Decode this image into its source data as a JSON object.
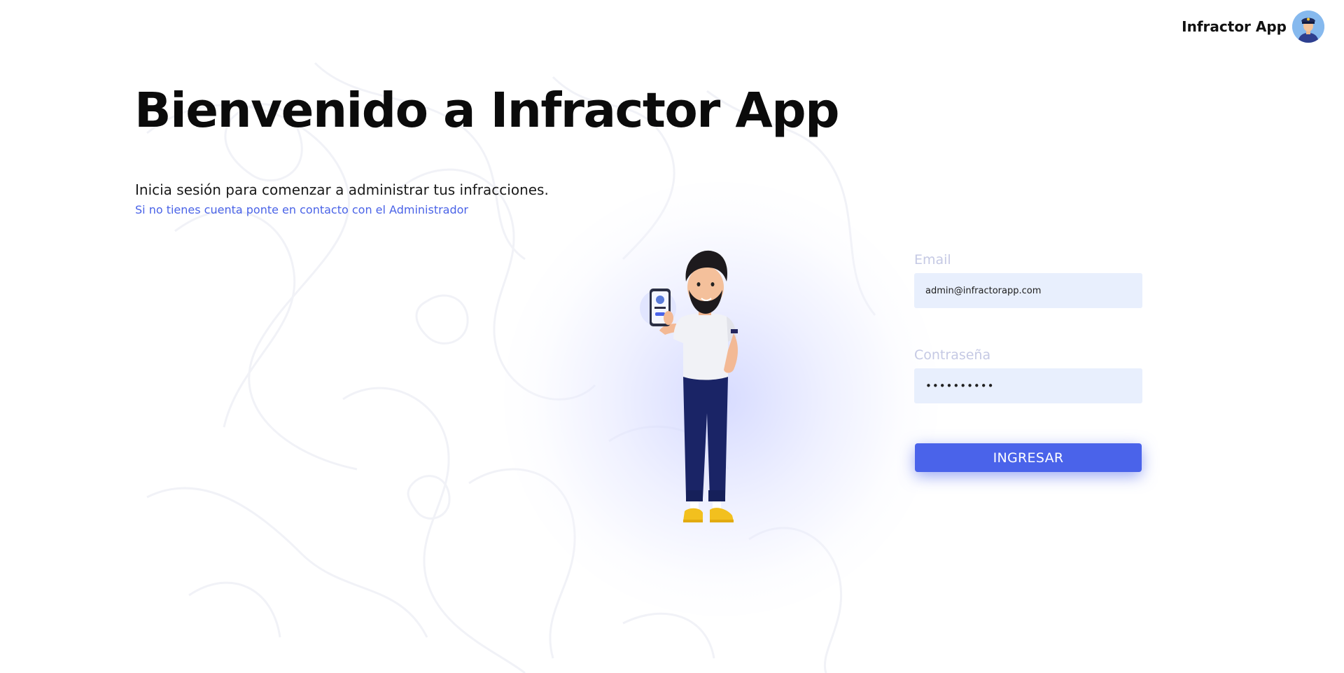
{
  "header": {
    "brand_name": "Infractor App",
    "avatar_icon": "police-officer-avatar-icon"
  },
  "hero": {
    "title": "Bienvenido a Infractor App",
    "subtitle": "Inicia sesión para comenzar a administrar tus infracciones.",
    "contact_link": "Si no tienes cuenta ponte en contacto con el Administrador"
  },
  "illustration": {
    "icon": "man-holding-phone-illustration"
  },
  "login": {
    "email_label": "Email",
    "email_value": "admin@infractorapp.com",
    "password_label": "Contraseña",
    "password_value": "••••••••••",
    "submit_label": "INGRESAR"
  },
  "colors": {
    "accent": "#4a63ea",
    "input_background": "#e8effd",
    "label_color": "#c5c9e4",
    "link_color": "#4a63e7"
  }
}
